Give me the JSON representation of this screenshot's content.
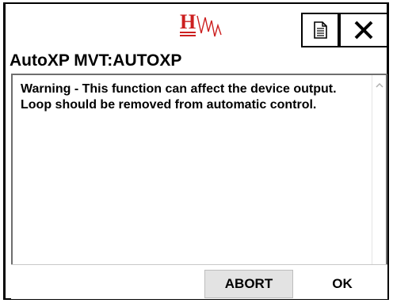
{
  "header": {
    "logo": {
      "letter": "H",
      "color": "#cc1f1f"
    },
    "document_button_icon": "document-icon",
    "close_button_icon": "close-icon"
  },
  "title": "AutoXP MVT:AUTOXP",
  "message": "Warning - This function can affect the device output. Loop should be removed from automatic control.",
  "scrollbar": {
    "up_icon": "chevron-up-icon",
    "down_icon": "chevron-down-icon"
  },
  "buttons": {
    "abort_label": "ABORT",
    "ok_label": "OK"
  }
}
